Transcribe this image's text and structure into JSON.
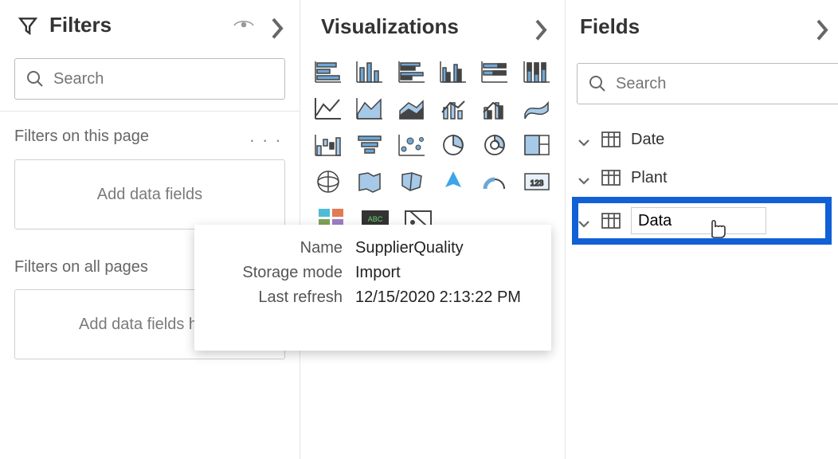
{
  "filters": {
    "title": "Filters",
    "search_placeholder": "Search",
    "sections": {
      "this_page": {
        "title": "Filters on this page",
        "drop_text": "Add data fields"
      },
      "all_pages": {
        "title": "Filters on all pages",
        "drop_text": "Add data fields here"
      }
    }
  },
  "visualizations": {
    "title": "Visualizations"
  },
  "fields": {
    "title": "Fields",
    "search_placeholder": "Search",
    "tables": {
      "t0": "Date",
      "t1": "Plant"
    },
    "rename_value": "Data"
  },
  "tooltip": {
    "name_label": "Name",
    "name_value": "SupplierQuality",
    "mode_label": "Storage mode",
    "mode_value": "Import",
    "refresh_label": "Last refresh",
    "refresh_value": "12/15/2020 2:13:22 PM"
  }
}
